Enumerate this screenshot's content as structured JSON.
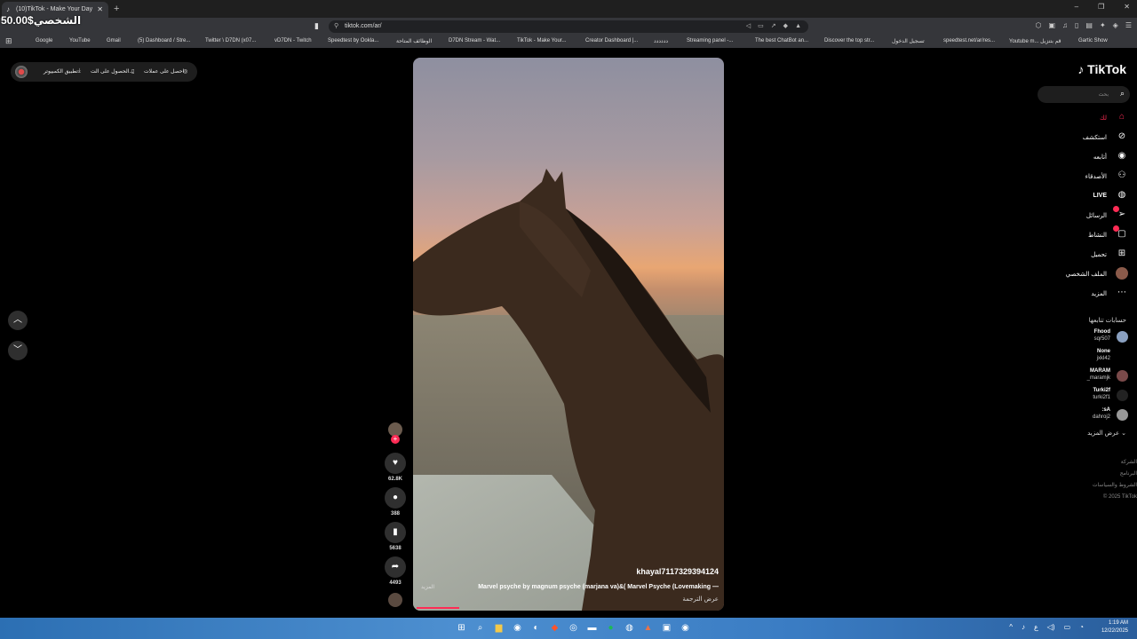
{
  "browser": {
    "tab_title": "(10)TikTok - Make Your Day",
    "url": "tiktok.com/ar/",
    "bookmarks": [
      "Google",
      "YouTube",
      "Gmail",
      "(5) Dashboard / Stre...",
      "Twitter \\ D7DN (x07...",
      "vD7DN - Twitch",
      "Speedtest by Ookla...",
      "الوظائف المتاحة",
      "D7DN Stream - Wat...",
      "TikTok - Make Your...",
      "Creator Dashboard |...",
      "دددددد",
      "Streaming panel -...",
      "The best ChatBot an...",
      "Discover the top str...",
      "تسجيل الدخول",
      "speedtest.net/ar/res...",
      "Youtube m... قم بتنزيل",
      "Gartic Show"
    ]
  },
  "overlay_text": "50.00$الشخصي",
  "promo": {
    "coins": "احصل على عملات",
    "get_app": "الحصول على الت...",
    "desktop_app": "تطبيق الكمبيوتر"
  },
  "video": {
    "username": "khayal7117329394124",
    "description": "Marvel psyche by magnum psyche (marjana va)&( Marvel Psyche (Lovemaking —",
    "more": "المزيد",
    "translate": "عرض الترجمة",
    "progress": 0.14
  },
  "actions": {
    "likes": "62.8K",
    "comments": "388",
    "saves": "5638",
    "shares": "4493"
  },
  "sidebar": {
    "logo": "TikTok",
    "search_placeholder": "بحث",
    "nav": [
      {
        "label": "لك",
        "icon": "home-icon"
      },
      {
        "label": "استكشف",
        "icon": "compass-icon"
      },
      {
        "label": "أتابعه",
        "icon": "following-icon"
      },
      {
        "label": "الأصدقاء",
        "icon": "friends-icon"
      },
      {
        "label": "LIVE",
        "icon": "live-icon"
      },
      {
        "label": "الرسائل",
        "icon": "messages-icon"
      },
      {
        "label": "النشاط",
        "icon": "activity-icon"
      },
      {
        "label": "تحميل",
        "icon": "upload-icon"
      },
      {
        "label": "الملف الشخصي",
        "icon": "profile-icon"
      },
      {
        "label": "المزيد",
        "icon": "more-icon"
      }
    ],
    "following_title": "حسابات تتابعها",
    "accounts": [
      {
        "name": "Fhood",
        "handle": "sqr507"
      },
      {
        "name": "None",
        "handle": "jxkl42"
      },
      {
        "name": "MARAM",
        "handle": "_maramjk"
      },
      {
        "name": "Turki2f",
        "handle": "turki2f1"
      },
      {
        "name": ":sA",
        "handle": "dahroj2"
      }
    ],
    "see_more": "عرض المزيد",
    "footer": [
      "الشركة",
      "البرنامج",
      "الشروط والسياسات",
      "© 2025 TikTok"
    ]
  },
  "taskbar": {
    "time": "1:19 AM",
    "date": "12/22/2025",
    "lang": "ع"
  }
}
